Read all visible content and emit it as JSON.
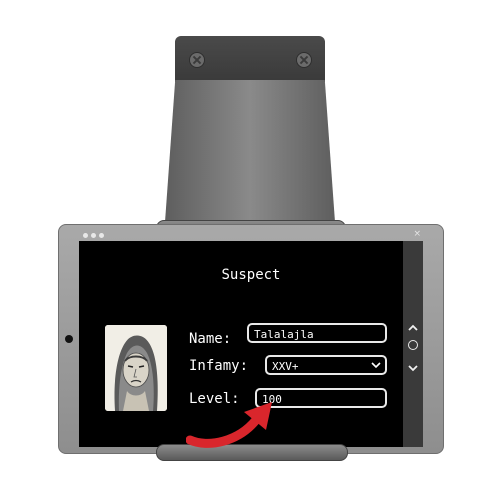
{
  "screen": {
    "title": "Suspect",
    "fields": {
      "name_label": "Name:",
      "name_value": "Talalajla",
      "infamy_label": "Infamy:",
      "infamy_value": "XXV+",
      "level_label": "Level:",
      "level_value": "100"
    }
  },
  "titlebar": {
    "close_glyph": "×"
  },
  "icons": {
    "window_dots": "three-dots-icon",
    "close": "close-icon",
    "nav_up": "chevron-up-icon",
    "nav_home": "circle-icon",
    "nav_down": "chevron-down-icon",
    "select_chevron": "chevron-down-icon",
    "annotation_arrow": "curved-arrow-icon"
  },
  "colors": {
    "screen_bg": "#000000",
    "text": "#ffffff",
    "field_border": "#e9e9e9",
    "arrow": "#d9262c",
    "tablet_frame": "#9c9c9c",
    "mount": "#6e6e6e"
  }
}
